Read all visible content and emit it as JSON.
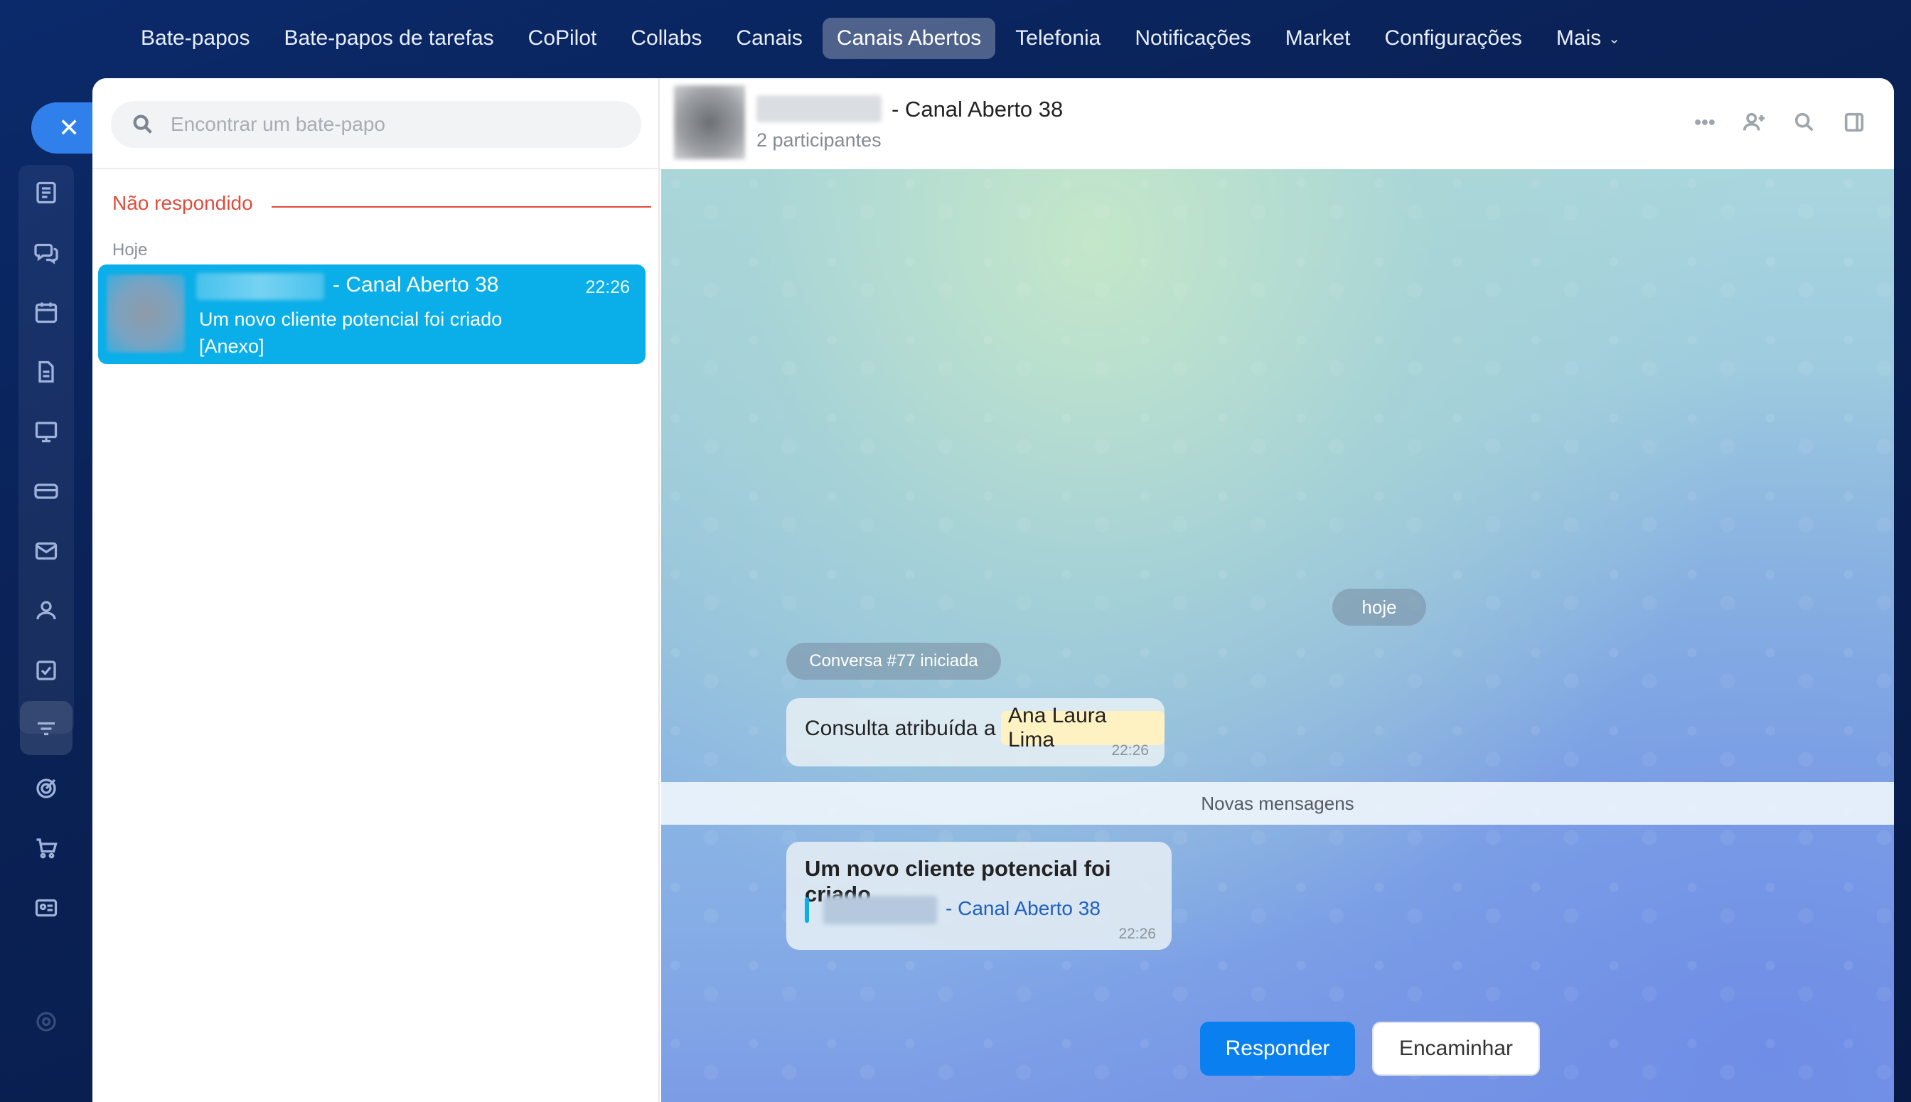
{
  "topnav": {
    "items": [
      {
        "label": "Bate-papos"
      },
      {
        "label": "Bate-papos de tarefas"
      },
      {
        "label": "CoPilot"
      },
      {
        "label": "Collabs"
      },
      {
        "label": "Canais"
      },
      {
        "label": "Canais Abertos",
        "active": true
      },
      {
        "label": "Telefonia"
      },
      {
        "label": "Notificações"
      },
      {
        "label": "Market"
      },
      {
        "label": "Configurações"
      },
      {
        "label": "Mais"
      }
    ]
  },
  "rail": {
    "icons": [
      "feed-icon",
      "chat-icon",
      "calendar-icon",
      "document-icon",
      "board-icon",
      "card-icon",
      "mail-icon",
      "users-icon",
      "task-icon",
      "filter-icon",
      "target-icon",
      "cart-icon",
      "contact-card-icon",
      "settings-icon"
    ]
  },
  "left": {
    "search_placeholder": "Encontrar um bate-papo",
    "section_label": "Não respondido",
    "day_label": "Hoje",
    "chat": {
      "title": "- Canal Aberto 38",
      "time": "22:26",
      "preview_line1": "Um novo cliente potencial foi criado",
      "preview_line2": "[Anexo]"
    }
  },
  "header": {
    "title": "- Canal Aberto 38",
    "subtitle": "2 participantes"
  },
  "messages": {
    "day_pill": "hoje",
    "conversation_started": "Conversa #77 iniciada",
    "assign_text": "Consulta atribuída a",
    "assign_name": "Ana Laura Lima",
    "assign_time": "22:26",
    "new_messages": "Novas mensagens",
    "lead_title": "Um novo cliente potencial foi criado",
    "lead_link": "- Canal Aberto 38",
    "lead_time": "22:26"
  },
  "actions": {
    "reply": "Responder",
    "forward": "Encaminhar"
  },
  "colors": {
    "accent": "#0a80f0",
    "selected_chat": "#0aaee8",
    "unanswered": "#e24b3b"
  }
}
